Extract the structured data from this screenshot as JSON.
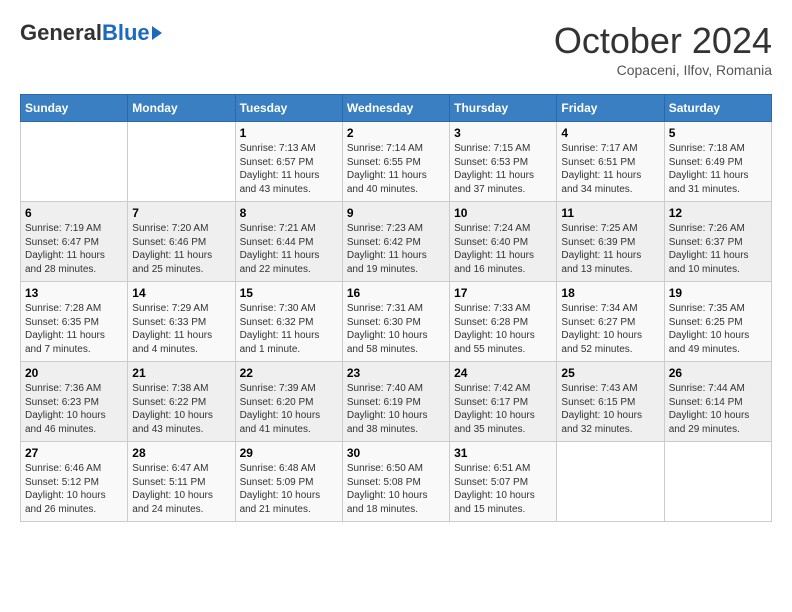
{
  "logo": {
    "general": "General",
    "blue": "Blue"
  },
  "header": {
    "month_year": "October 2024",
    "location": "Copaceni, Ilfov, Romania"
  },
  "days_of_week": [
    "Sunday",
    "Monday",
    "Tuesday",
    "Wednesday",
    "Thursday",
    "Friday",
    "Saturday"
  ],
  "weeks": [
    [
      {
        "day": "",
        "sunrise": "",
        "sunset": "",
        "daylight": ""
      },
      {
        "day": "",
        "sunrise": "",
        "sunset": "",
        "daylight": ""
      },
      {
        "day": "1",
        "sunrise": "Sunrise: 7:13 AM",
        "sunset": "Sunset: 6:57 PM",
        "daylight": "Daylight: 11 hours and 43 minutes."
      },
      {
        "day": "2",
        "sunrise": "Sunrise: 7:14 AM",
        "sunset": "Sunset: 6:55 PM",
        "daylight": "Daylight: 11 hours and 40 minutes."
      },
      {
        "day": "3",
        "sunrise": "Sunrise: 7:15 AM",
        "sunset": "Sunset: 6:53 PM",
        "daylight": "Daylight: 11 hours and 37 minutes."
      },
      {
        "day": "4",
        "sunrise": "Sunrise: 7:17 AM",
        "sunset": "Sunset: 6:51 PM",
        "daylight": "Daylight: 11 hours and 34 minutes."
      },
      {
        "day": "5",
        "sunrise": "Sunrise: 7:18 AM",
        "sunset": "Sunset: 6:49 PM",
        "daylight": "Daylight: 11 hours and 31 minutes."
      }
    ],
    [
      {
        "day": "6",
        "sunrise": "Sunrise: 7:19 AM",
        "sunset": "Sunset: 6:47 PM",
        "daylight": "Daylight: 11 hours and 28 minutes."
      },
      {
        "day": "7",
        "sunrise": "Sunrise: 7:20 AM",
        "sunset": "Sunset: 6:46 PM",
        "daylight": "Daylight: 11 hours and 25 minutes."
      },
      {
        "day": "8",
        "sunrise": "Sunrise: 7:21 AM",
        "sunset": "Sunset: 6:44 PM",
        "daylight": "Daylight: 11 hours and 22 minutes."
      },
      {
        "day": "9",
        "sunrise": "Sunrise: 7:23 AM",
        "sunset": "Sunset: 6:42 PM",
        "daylight": "Daylight: 11 hours and 19 minutes."
      },
      {
        "day": "10",
        "sunrise": "Sunrise: 7:24 AM",
        "sunset": "Sunset: 6:40 PM",
        "daylight": "Daylight: 11 hours and 16 minutes."
      },
      {
        "day": "11",
        "sunrise": "Sunrise: 7:25 AM",
        "sunset": "Sunset: 6:39 PM",
        "daylight": "Daylight: 11 hours and 13 minutes."
      },
      {
        "day": "12",
        "sunrise": "Sunrise: 7:26 AM",
        "sunset": "Sunset: 6:37 PM",
        "daylight": "Daylight: 11 hours and 10 minutes."
      }
    ],
    [
      {
        "day": "13",
        "sunrise": "Sunrise: 7:28 AM",
        "sunset": "Sunset: 6:35 PM",
        "daylight": "Daylight: 11 hours and 7 minutes."
      },
      {
        "day": "14",
        "sunrise": "Sunrise: 7:29 AM",
        "sunset": "Sunset: 6:33 PM",
        "daylight": "Daylight: 11 hours and 4 minutes."
      },
      {
        "day": "15",
        "sunrise": "Sunrise: 7:30 AM",
        "sunset": "Sunset: 6:32 PM",
        "daylight": "Daylight: 11 hours and 1 minute."
      },
      {
        "day": "16",
        "sunrise": "Sunrise: 7:31 AM",
        "sunset": "Sunset: 6:30 PM",
        "daylight": "Daylight: 10 hours and 58 minutes."
      },
      {
        "day": "17",
        "sunrise": "Sunrise: 7:33 AM",
        "sunset": "Sunset: 6:28 PM",
        "daylight": "Daylight: 10 hours and 55 minutes."
      },
      {
        "day": "18",
        "sunrise": "Sunrise: 7:34 AM",
        "sunset": "Sunset: 6:27 PM",
        "daylight": "Daylight: 10 hours and 52 minutes."
      },
      {
        "day": "19",
        "sunrise": "Sunrise: 7:35 AM",
        "sunset": "Sunset: 6:25 PM",
        "daylight": "Daylight: 10 hours and 49 minutes."
      }
    ],
    [
      {
        "day": "20",
        "sunrise": "Sunrise: 7:36 AM",
        "sunset": "Sunset: 6:23 PM",
        "daylight": "Daylight: 10 hours and 46 minutes."
      },
      {
        "day": "21",
        "sunrise": "Sunrise: 7:38 AM",
        "sunset": "Sunset: 6:22 PM",
        "daylight": "Daylight: 10 hours and 43 minutes."
      },
      {
        "day": "22",
        "sunrise": "Sunrise: 7:39 AM",
        "sunset": "Sunset: 6:20 PM",
        "daylight": "Daylight: 10 hours and 41 minutes."
      },
      {
        "day": "23",
        "sunrise": "Sunrise: 7:40 AM",
        "sunset": "Sunset: 6:19 PM",
        "daylight": "Daylight: 10 hours and 38 minutes."
      },
      {
        "day": "24",
        "sunrise": "Sunrise: 7:42 AM",
        "sunset": "Sunset: 6:17 PM",
        "daylight": "Daylight: 10 hours and 35 minutes."
      },
      {
        "day": "25",
        "sunrise": "Sunrise: 7:43 AM",
        "sunset": "Sunset: 6:15 PM",
        "daylight": "Daylight: 10 hours and 32 minutes."
      },
      {
        "day": "26",
        "sunrise": "Sunrise: 7:44 AM",
        "sunset": "Sunset: 6:14 PM",
        "daylight": "Daylight: 10 hours and 29 minutes."
      }
    ],
    [
      {
        "day": "27",
        "sunrise": "Sunrise: 6:46 AM",
        "sunset": "Sunset: 5:12 PM",
        "daylight": "Daylight: 10 hours and 26 minutes."
      },
      {
        "day": "28",
        "sunrise": "Sunrise: 6:47 AM",
        "sunset": "Sunset: 5:11 PM",
        "daylight": "Daylight: 10 hours and 24 minutes."
      },
      {
        "day": "29",
        "sunrise": "Sunrise: 6:48 AM",
        "sunset": "Sunset: 5:09 PM",
        "daylight": "Daylight: 10 hours and 21 minutes."
      },
      {
        "day": "30",
        "sunrise": "Sunrise: 6:50 AM",
        "sunset": "Sunset: 5:08 PM",
        "daylight": "Daylight: 10 hours and 18 minutes."
      },
      {
        "day": "31",
        "sunrise": "Sunrise: 6:51 AM",
        "sunset": "Sunset: 5:07 PM",
        "daylight": "Daylight: 10 hours and 15 minutes."
      },
      {
        "day": "",
        "sunrise": "",
        "sunset": "",
        "daylight": ""
      },
      {
        "day": "",
        "sunrise": "",
        "sunset": "",
        "daylight": ""
      }
    ]
  ]
}
